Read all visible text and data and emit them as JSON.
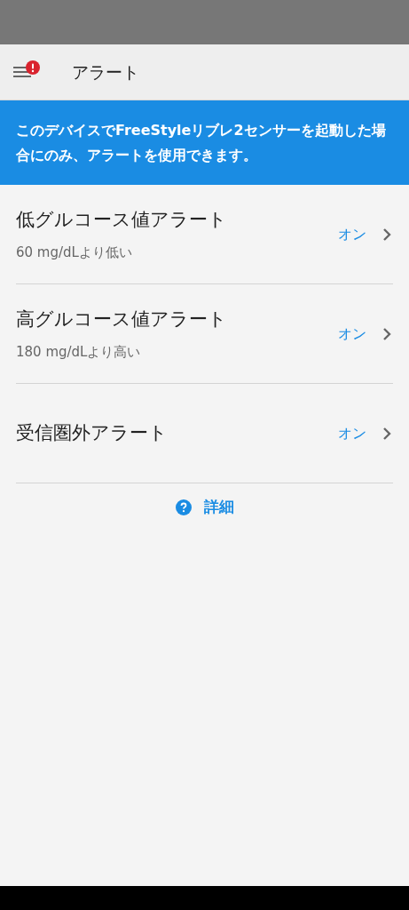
{
  "header": {
    "title": "アラート",
    "menu_badge": true
  },
  "banner": {
    "text": "このデバイスでFreeStyleリブレ2センサーを起動した場合にのみ、アラートを使用できます。"
  },
  "alerts": [
    {
      "title": "低グルコース値アラート",
      "subtitle": "60 mg/dLより低い",
      "status": "オン"
    },
    {
      "title": "高グルコース値アラート",
      "subtitle": "180 mg/dLより高い",
      "status": "オン"
    },
    {
      "title": "受信圏外アラート",
      "status": "オン"
    }
  ],
  "help_link": {
    "label": "詳細"
  }
}
